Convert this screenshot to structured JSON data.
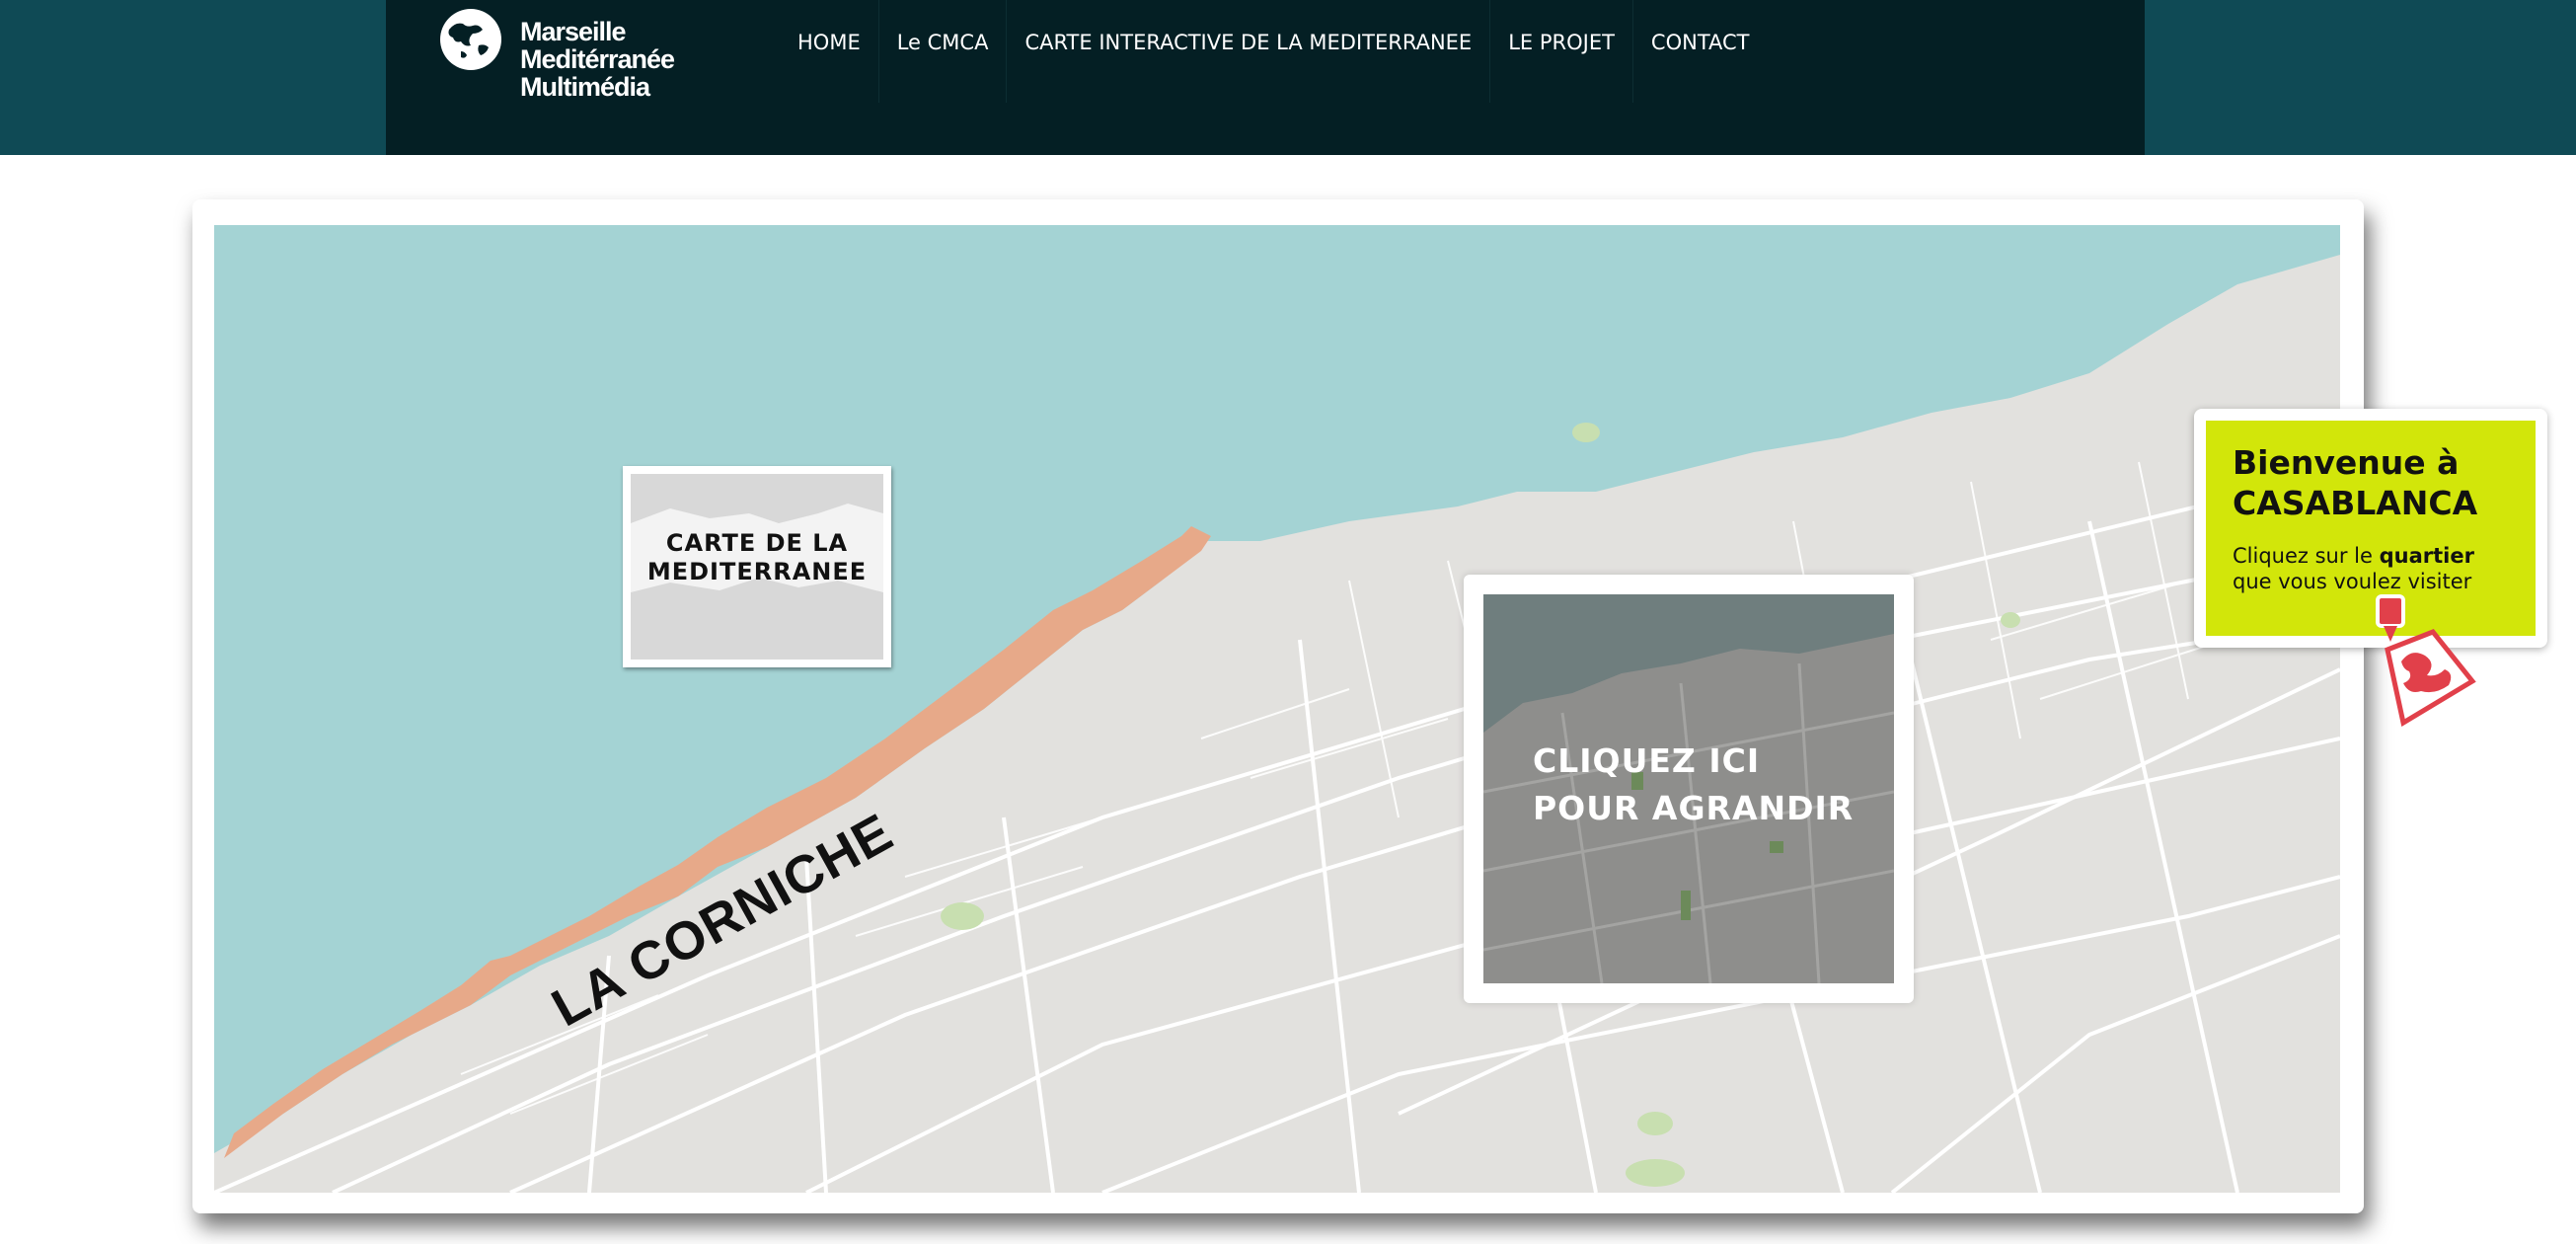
{
  "header": {
    "logo_lines": [
      "Marseille",
      "Meditérranée",
      "Multimédia"
    ],
    "logo_icon": "globe-icon"
  },
  "nav": {
    "items": [
      {
        "label": "HOME"
      },
      {
        "label": "Le CMCA"
      },
      {
        "label": "CARTE INTERACTIVE DE LA MEDITERRANEE"
      },
      {
        "label": "LE PROJET"
      },
      {
        "label": "CONTACT"
      }
    ]
  },
  "map": {
    "corniche_label": "LA CORNICHE",
    "mediterranee_link": {
      "line1": "CARTE DE LA",
      "line2": "MEDITERRANEE"
    },
    "zoom_link": {
      "line1": "CLIQUEZ ICI",
      "line2": "POUR AGRANDIR"
    },
    "colors": {
      "sea": "#a4d3d4",
      "land": "#e2e1de",
      "corniche": "#e7a989",
      "welcome_bg": "#d2e60a",
      "header": "#041f24",
      "topbar": "#0f4a55"
    }
  },
  "welcome": {
    "title_line1": "Bienvenue à",
    "title_line2": "CASABLANCA",
    "text_line1_prefix": "Cliquez sur le ",
    "text_line1_bold": "quartier",
    "text_line2": "que vous voulez visiter",
    "icon": "district-pin-icon"
  }
}
